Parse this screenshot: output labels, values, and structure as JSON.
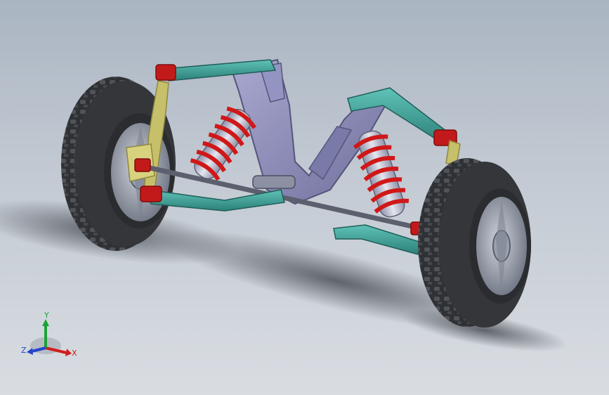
{
  "viewport": {
    "model": "front-suspension-assembly",
    "colors": {
      "background_top": "#aab5c2",
      "background_bottom": "#d9dde2",
      "tire": "#2b2d30",
      "rim": "#8f95a3",
      "frame": "#8a8ab4",
      "control_arm": "#3aa39a",
      "bracket": "#c21a1a",
      "spring": "#d01818",
      "damper": "#c2c6d6",
      "knuckle": "#c7c06a"
    }
  },
  "triad": {
    "x_label": "X",
    "y_label": "Y",
    "z_label": "Z",
    "x_color": "#d21d1d",
    "y_color": "#1aa337",
    "z_color": "#2346c9"
  }
}
